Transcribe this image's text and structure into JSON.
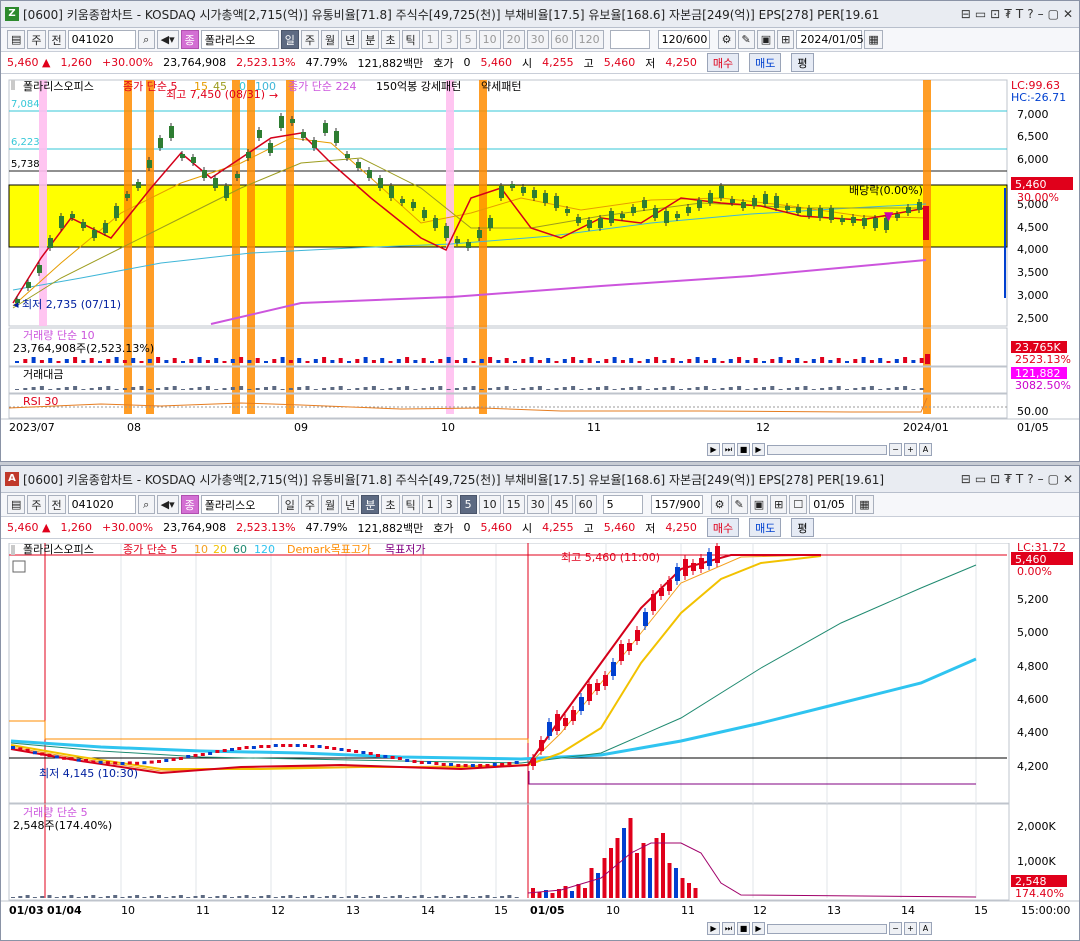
{
  "top": {
    "badge": "Z",
    "badge_color": "#2d8a2d",
    "title": "[0600] 키움종합차트 - KOSDAQ 시가총액[2,715(억)] 유통비율[71.8] 주식수[49,725(천)] 부채비율[17.5] 유보율[168.6] 자본금[249(억)] EPS[278] PER[19.61",
    "controls": [
      "⊟",
      "▭",
      "⊡",
      "₮",
      "T",
      "?",
      "–",
      "▢",
      "✕"
    ],
    "toolbar": {
      "ju": "주",
      "jeon": "전",
      "code": "041020",
      "name": "폴라리스오",
      "periods": [
        "일",
        "주",
        "월",
        "년",
        "분",
        "초",
        "틱"
      ],
      "nums": [
        "1",
        "3",
        "5",
        "10",
        "20",
        "30",
        "60",
        "120"
      ],
      "count": "120/600",
      "date": "2024/01/05"
    },
    "quote": {
      "price": "5,460",
      "change": "1,260",
      "pct": "+30.00%",
      "volume": "23,764,908",
      "vol_ratio": "2,523.13%",
      "turnover": "47.79%",
      "amount": "121,882백만",
      "hoga_label": "호가",
      "hoga": "0",
      "hoga_price": "5,460",
      "open_label": "시",
      "open": "4,255",
      "high_label": "고",
      "high": "5,460",
      "low_label": "저",
      "low": "4,250",
      "buy": "매수",
      "sell": "매도",
      "eval": "평"
    },
    "legend": {
      "name": "폴라리스오피스",
      "ma": "종가 단순 5",
      "ma_periods": [
        "15",
        "45",
        "0",
        "100"
      ],
      "ma2": "종가 단순 224",
      "pattern1": "150억봉 강세패턴",
      "pattern2": "약세패턴"
    },
    "lc": "LC:99.63",
    "hc": "HC:-26.71",
    "y_labels": [
      "7,000",
      "6,500",
      "6,000",
      "5,500",
      "5,000",
      "4,500",
      "4,000",
      "3,500",
      "3,000",
      "2,500"
    ],
    "price_box": "5,460",
    "pct_box": "30.00%",
    "hlines": [
      "7,084",
      "6,223",
      "5,738"
    ],
    "hi_note": "최고 7,450 (08/31)",
    "lo_note": "최저 2,735 (07/11)",
    "div_note": "배당락(0.00%)",
    "vol_title": "거래량 단순 10",
    "vol_value": "23,764,908주(2,523.13%)",
    "vol_box1": "23,765K",
    "vol_box2": "2523.13%",
    "amt_title": "거래대금",
    "amt_box1": "121,882",
    "amt_box2": "3082.50%",
    "rsi_title": "RSI 30",
    "rsi_label": "50.00",
    "x_labels": [
      "2023/07",
      "08",
      "09",
      "10",
      "11",
      "12",
      "2024/01",
      "01/05"
    ]
  },
  "bottom": {
    "badge": "A",
    "badge_color": "#c0392b",
    "title": "[0600] 키움종합차트 - KOSDAQ 시가총액[2,715(억)] 유통비율[71.8] 주식수[49,725(천)] 부채비율[17.5] 유보율[168.6] 자본금[249(억)] EPS[278] PER[19.61]",
    "controls": [
      "⊟",
      "▭",
      "⊡",
      "₮",
      "T",
      "?",
      "–",
      "▢",
      "✕"
    ],
    "toolbar": {
      "ju": "주",
      "jeon": "전",
      "code": "041020",
      "name": "폴라리스오",
      "periods": [
        "일",
        "주",
        "월",
        "년",
        "분",
        "초",
        "틱"
      ],
      "nums": [
        "1",
        "3",
        "5",
        "10",
        "15",
        "30",
        "45",
        "60"
      ],
      "interval": "5",
      "count": "157/900",
      "date": "01/05"
    },
    "quote": {
      "price": "5,460",
      "change": "1,260",
      "pct": "+30.00%",
      "volume": "23,764,908",
      "vol_ratio": "2,523.13%",
      "turnover": "47.79%",
      "amount": "121,882백만",
      "hoga_label": "호가",
      "hoga": "0",
      "hoga_price": "5,460",
      "open_label": "시",
      "open": "4,255",
      "high_label": "고",
      "high": "5,460",
      "low_label": "저",
      "low": "4,250",
      "buy": "매수",
      "sell": "매도",
      "eval": "평"
    },
    "legend": {
      "name": "폴라리스오피스",
      "ma": "종가 단순 5",
      "ma_periods": [
        "10",
        "20",
        "60",
        "120"
      ],
      "demark": "Demark목표고가",
      "demark2": "목표저가"
    },
    "lc": "LC:31.72",
    "y_labels": [
      "5,200",
      "5,000",
      "4,800",
      "4,600",
      "4,400",
      "4,200"
    ],
    "price_box": "5,460",
    "pct_box": "0.00%",
    "hi_note": "최고 5,460 (11:00)",
    "lo_note": "최저 4,145 (10:30)",
    "vol_title": "거래량 단순 5",
    "vol_value": "2,548주(174.40%)",
    "vol_y": [
      "2,000K",
      "1,000K"
    ],
    "vol_box1": "2,548",
    "vol_box2": "174.40%",
    "x_labels": [
      "01/03",
      "01/04",
      "10",
      "11",
      "12",
      "13",
      "14",
      "15",
      "01/05",
      "10",
      "11",
      "12",
      "13",
      "14",
      "15"
    ],
    "time_label": "15:00:00"
  },
  "colors": {
    "up": "#e0001b",
    "down": "#0040d0",
    "yellow": "#ffff00",
    "orange": "#ff8c00",
    "pink": "#ffbff0",
    "violet": "#cc55dd",
    "cyan": "#2fc4f0"
  }
}
